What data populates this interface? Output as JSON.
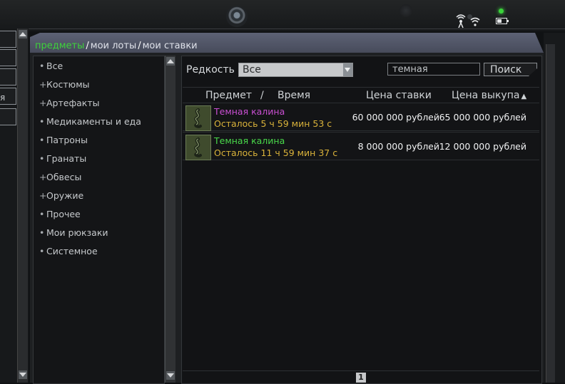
{
  "tabs": {
    "items": [
      "предметы",
      "мои лоты",
      "мои ставки"
    ],
    "separator": "/",
    "active_color": "#3ed23b",
    "inactive_color": "#dfe2ea"
  },
  "left_edge": {
    "fragment": "я"
  },
  "categories": [
    {
      "mark": "•",
      "label": "Все"
    },
    {
      "mark": "+",
      "label": "Костюмы"
    },
    {
      "mark": "+",
      "label": "Артефакты"
    },
    {
      "mark": "•",
      "label": "Медикаменты и еда"
    },
    {
      "mark": "•",
      "label": "Патроны"
    },
    {
      "mark": "•",
      "label": "Гранаты"
    },
    {
      "mark": "+",
      "label": "Обвесы"
    },
    {
      "mark": "+",
      "label": "Оружие"
    },
    {
      "mark": "•",
      "label": "Прочее"
    },
    {
      "mark": "•",
      "label": "Мои рюкзаки"
    },
    {
      "mark": "•",
      "label": "Системное"
    }
  ],
  "filters": {
    "rarity_label": "Редкость",
    "rarity_value": "Все",
    "search_value": "темная",
    "search_button": "Поиск"
  },
  "table": {
    "col_item": "Предмет",
    "col_sep": "/",
    "col_time": "Время",
    "col_bid": "Цена ставки",
    "col_buyout": "Цена выкупа",
    "sort_icon": "▲",
    "rows": [
      {
        "name": "Темная калина",
        "name_color": "#c94fd2",
        "time_left": "Осталось 5 ч 59 мин 53 с",
        "bid": "60 000 000 рублей",
        "buyout": "65 000 000 рублей"
      },
      {
        "name": "Темная калина",
        "name_color": "#49d84a",
        "time_left": "Осталось 11 ч 59 мин 37 с",
        "bid": "8 000 000 рублей",
        "buyout": "12 000 000 рублей"
      }
    ]
  },
  "pagination": {
    "current_page": "1"
  },
  "icons": {
    "item_icon": "artifact-icon",
    "wifi": "wifi-icon",
    "battery": "battery-icon"
  }
}
